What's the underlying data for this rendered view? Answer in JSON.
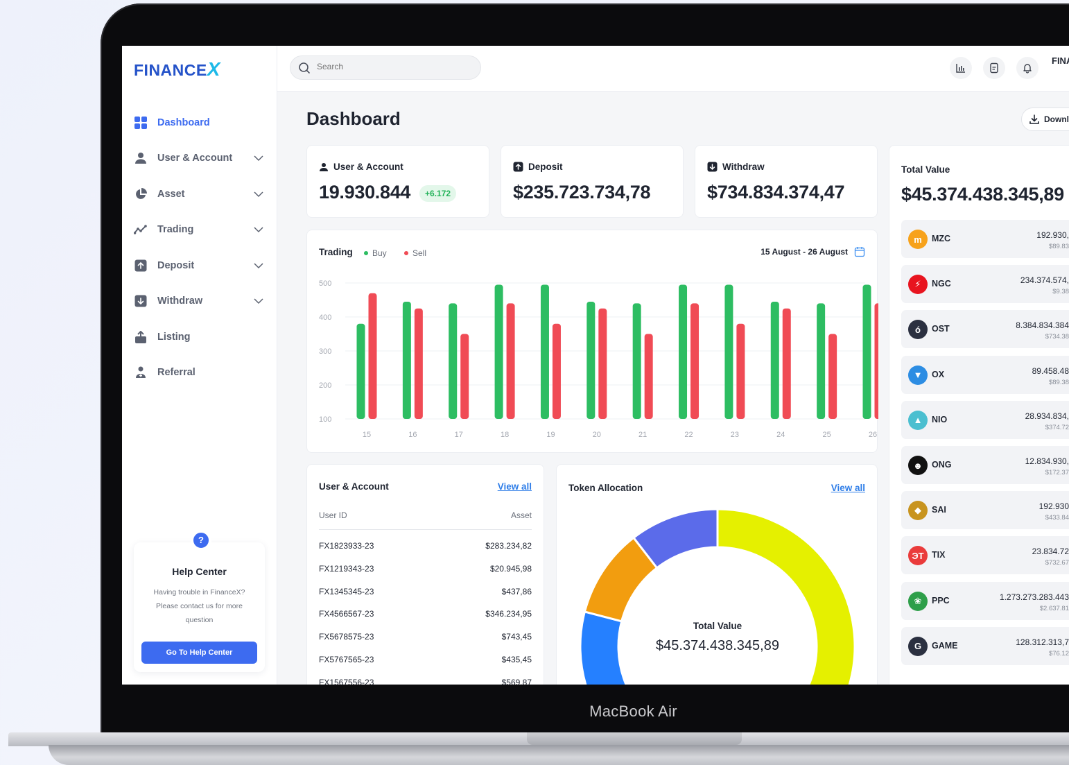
{
  "device_label": "MacBook Air",
  "sidebar": {
    "logo_text": "FINANCE",
    "logo_x": "X",
    "items": [
      {
        "label": "Dashboard",
        "icon": "grid-icon",
        "active": true,
        "chevron": false
      },
      {
        "label": "User & Account",
        "icon": "user-icon",
        "active": false,
        "chevron": true
      },
      {
        "label": "Asset",
        "icon": "pie-icon",
        "active": false,
        "chevron": true
      },
      {
        "label": "Trading",
        "icon": "trend-icon",
        "active": false,
        "chevron": true
      },
      {
        "label": "Deposit",
        "icon": "arrow-up-box-icon",
        "active": false,
        "chevron": true
      },
      {
        "label": "Withdraw",
        "icon": "arrow-down-box-icon",
        "active": false,
        "chevron": true
      },
      {
        "label": "Listing",
        "icon": "upload-icon",
        "active": false,
        "chevron": false
      },
      {
        "label": "Referral",
        "icon": "referral-icon",
        "active": false,
        "chevron": false
      }
    ],
    "help": {
      "badge": "?",
      "title": "Help Center",
      "text": "Having trouble in FinanceX? Please contact us for more question",
      "button": "Go To Help Center"
    }
  },
  "topbar": {
    "search_placeholder": "Search",
    "user_name": "FINA"
  },
  "main": {
    "title": "Dashboard",
    "download_label": "Downl",
    "stats": [
      {
        "label": "User & Account",
        "value": "19.930.844",
        "badge": "+6.172"
      },
      {
        "label": "Deposit",
        "value": "$235.723.734,78"
      },
      {
        "label": "Withdraw",
        "value": "$734.834.374,47"
      }
    ]
  },
  "trading": {
    "title": "Trading",
    "legend_buy": "Buy",
    "legend_sell": "Sell",
    "date_range": "15 August - 26 August"
  },
  "chart_data": {
    "type": "bar",
    "title": "Trading",
    "categories": [
      "15",
      "16",
      "17",
      "18",
      "19",
      "20",
      "21",
      "22",
      "23",
      "24",
      "25",
      "26"
    ],
    "series": [
      {
        "name": "Buy",
        "color": "#2dbd62",
        "values": [
          380,
          445,
          440,
          495,
          495,
          445,
          440,
          495,
          495,
          445,
          440,
          495
        ]
      },
      {
        "name": "Sell",
        "color": "#f04b55",
        "values": [
          470,
          425,
          350,
          440,
          380,
          425,
          350,
          440,
          380,
          425,
          350,
          440
        ]
      }
    ],
    "y_ticks": [
      500,
      400,
      300,
      200,
      100
    ],
    "ylim": [
      100,
      500
    ],
    "grid": true
  },
  "user_table": {
    "title": "User & Account",
    "view_all": "View all",
    "col_user": "User ID",
    "col_asset": "Asset",
    "rows": [
      {
        "id": "FX1823933-23",
        "asset": "$283.234,82"
      },
      {
        "id": "FX1219343-23",
        "asset": "$20.945,98"
      },
      {
        "id": "FX1345345-23",
        "asset": "$437,86"
      },
      {
        "id": "FX4566567-23",
        "asset": "$346.234,95"
      },
      {
        "id": "FX5678575-23",
        "asset": "$743,45"
      },
      {
        "id": "FX5767565-23",
        "asset": "$435,45"
      },
      {
        "id": "FX1567556-23",
        "asset": "$569,87"
      }
    ]
  },
  "token_allocation": {
    "title": "Token Allocation",
    "view_all": "View all",
    "center_label": "Total Value",
    "center_value": "$45.374.438.345,89",
    "segments": [
      {
        "color": "#e5f000",
        "value": 27
      },
      {
        "color": "#5cc000",
        "value": 9
      },
      {
        "color": "#2580ff",
        "value": 32
      },
      {
        "color": "#f29d0f",
        "value": 9
      },
      {
        "color": "#5b6bea",
        "value": 9
      }
    ]
  },
  "total_value": {
    "label": "Total Value",
    "value": "$45.374.438.345,89",
    "coins": [
      {
        "sym": "MZC",
        "amount": "192.930,",
        "usd": "$89.83",
        "color": "#f7a21b",
        "glyph": "m"
      },
      {
        "sym": "NGC",
        "amount": "234.374.574,",
        "usd": "$9.38",
        "color": "#e8141f",
        "glyph": "⚡"
      },
      {
        "sym": "OST",
        "amount": "8.384.834.384",
        "usd": "$734.38",
        "color": "#2b3040",
        "glyph": "ó"
      },
      {
        "sym": "OX",
        "amount": "89.458.48",
        "usd": "$89.38",
        "color": "#2d8de3",
        "glyph": "▼"
      },
      {
        "sym": "NIO",
        "amount": "28.934.834,",
        "usd": "$374.72",
        "color": "#4bbfd0",
        "glyph": "▲"
      },
      {
        "sym": "ONG",
        "amount": "12.834.930,",
        "usd": "$172.37",
        "color": "#111111",
        "glyph": "☻"
      },
      {
        "sym": "SAI",
        "amount": "192.930",
        "usd": "$433.84",
        "color": "#c8941f",
        "glyph": "◆"
      },
      {
        "sym": "TIX",
        "amount": "23.834.72",
        "usd": "$732.67",
        "color": "#ea3b3b",
        "glyph": "ЭT"
      },
      {
        "sym": "PPC",
        "amount": "1.273.273.283.443",
        "usd": "$2.637.81",
        "color": "#2e9f4a",
        "glyph": "❀"
      },
      {
        "sym": "GAME",
        "amount": "128.312.313,7",
        "usd": "$76.12",
        "color": "#2b3040",
        "glyph": "G"
      }
    ]
  }
}
